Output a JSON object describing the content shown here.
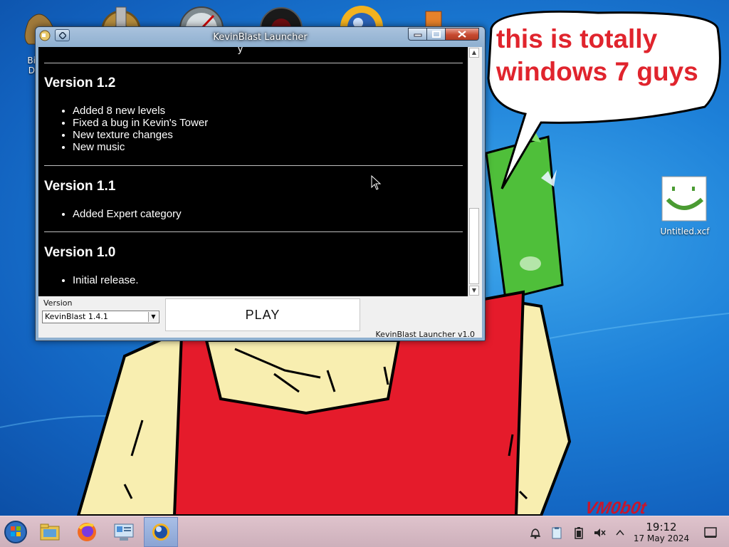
{
  "desktop": {
    "icons": [
      {
        "label": "Big",
        "label2": "De",
        "icon": "money-bag-icon"
      },
      {
        "label": "Untitled.xcf",
        "icon": "smiley-image-icon"
      }
    ],
    "watermark": "VM0b0t",
    "speech_bubble": {
      "line1": "this is totally",
      "line2": "windows 7 guys"
    }
  },
  "window": {
    "title": "KevinBlast Launcher",
    "changelog": [
      {
        "heading": "Version 1.2",
        "items": [
          "Added 8 new levels",
          "Fixed a bug in Kevin's Tower",
          "New texture changes",
          "New music"
        ]
      },
      {
        "heading": "Version 1.1",
        "items": [
          "Added Expert category"
        ]
      },
      {
        "heading": "Version 1.0",
        "items": [
          "Initial release."
        ]
      }
    ],
    "version_label": "Version",
    "version_selected": "KevinBlast 1.4.1",
    "play_label": "PLAY",
    "launcher_version": "KevinBlast Launcher v1.0"
  },
  "taskbar": {
    "apps": [
      "start-orb-icon",
      "file-manager-icon",
      "firefox-icon",
      "system-settings-icon",
      "kevinblast-icon"
    ],
    "clock_time": "19:12",
    "clock_date": "17 May 2024"
  },
  "colors": {
    "bubble_text": "#e0242d",
    "desktop_blue": "#1d80d8",
    "shirt_red": "#e51b2b"
  }
}
